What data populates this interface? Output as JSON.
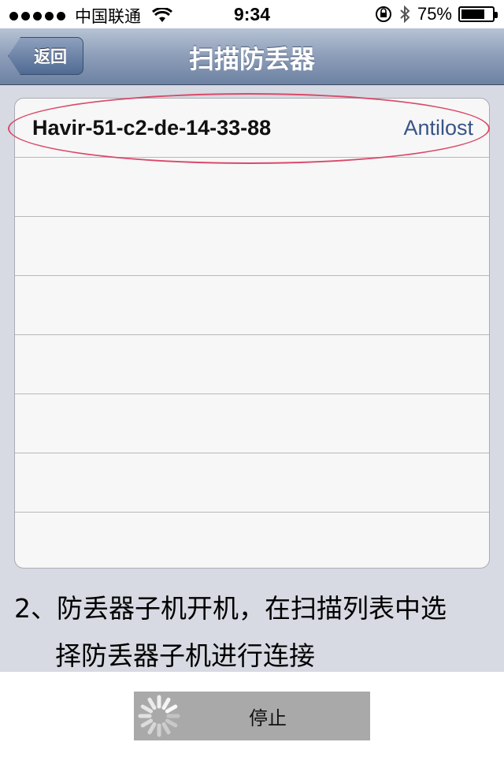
{
  "status_bar": {
    "carrier": "中国联通",
    "time": "9:34",
    "battery": "75%",
    "battery_level": 0.75
  },
  "nav": {
    "back_label": "返回",
    "title": "扫描防丢器"
  },
  "devices": [
    {
      "name": "Havir-51-c2-de-14-33-88",
      "type": "Antilost"
    }
  ],
  "instruction": {
    "line1": "2、防丢器子机开机，在扫描列表中选",
    "line2": "择防丢器子机进行连接"
  },
  "bottom": {
    "stop_label": "停止"
  },
  "colors": {
    "accent": "#385487",
    "highlight": "#d94a6a"
  }
}
